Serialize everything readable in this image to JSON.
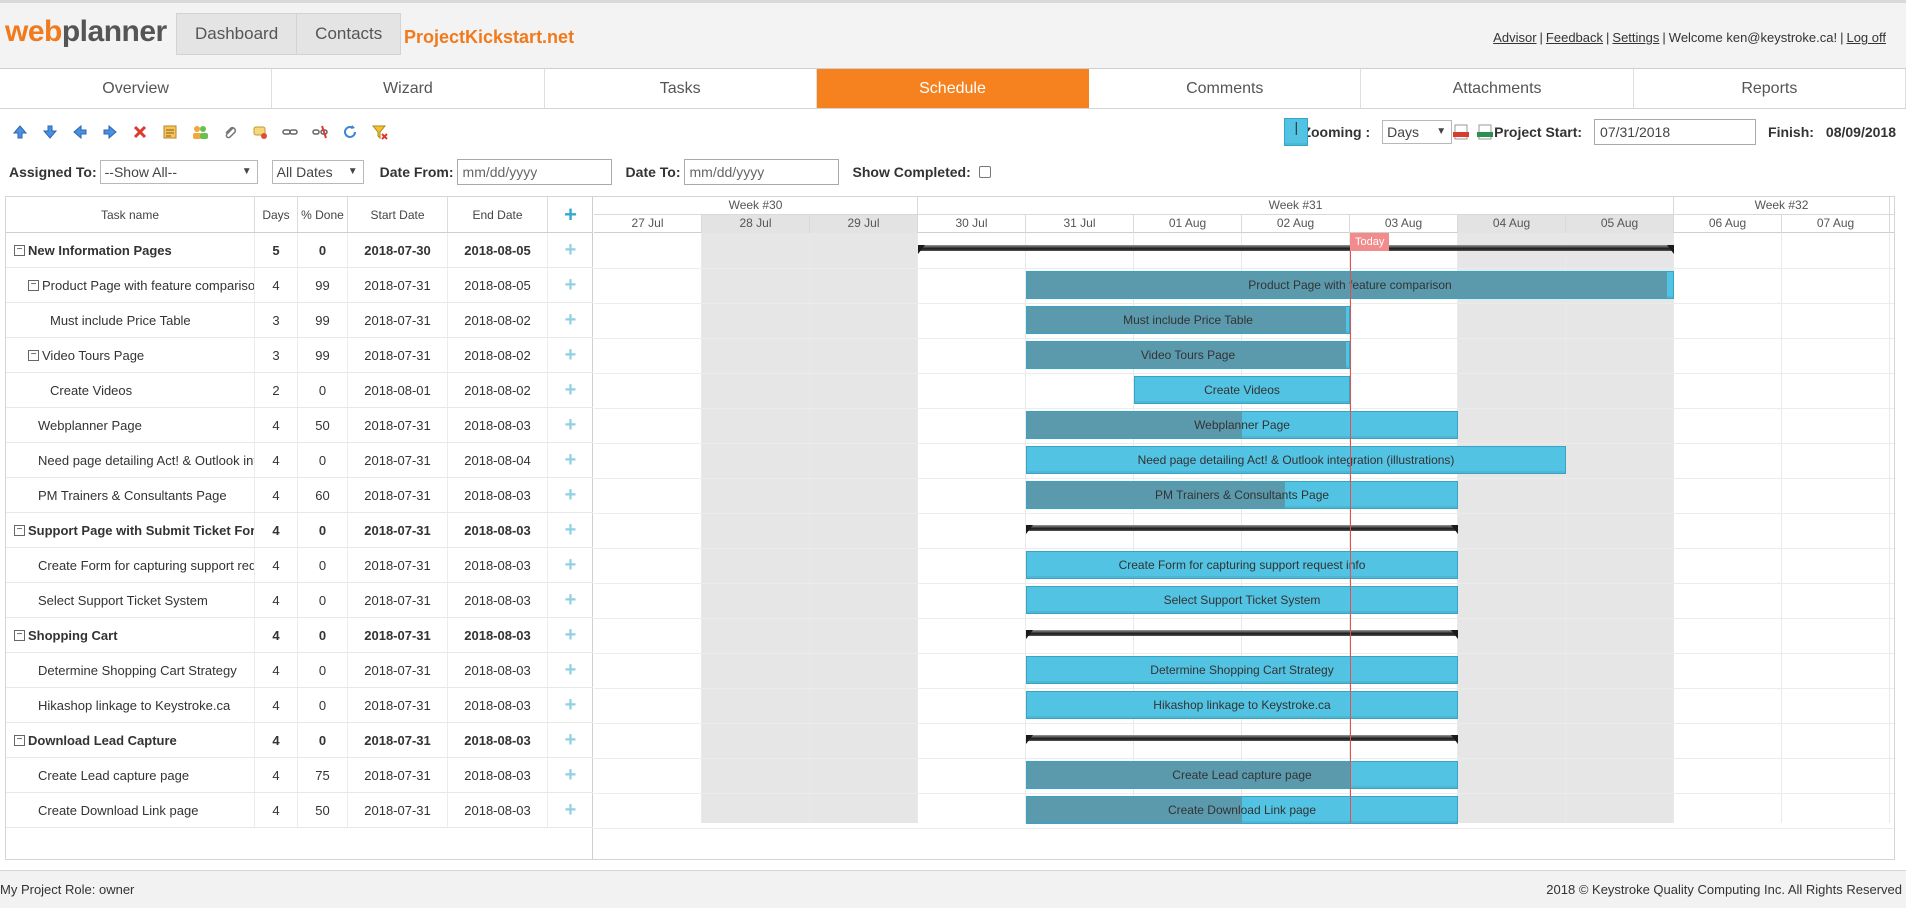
{
  "app": {
    "logo_part1": "web",
    "logo_part2": "planner",
    "nav_dashboard": "Dashboard",
    "nav_contacts": "Contacts",
    "project_name": "ProjectKickstart.net",
    "user_links": {
      "advisor": "Advisor",
      "feedback": "Feedback",
      "settings": "Settings",
      "welcome": "Welcome ken@keystroke.ca!",
      "logoff": "Log off"
    }
  },
  "tabs": [
    "Overview",
    "Wizard",
    "Tasks",
    "Schedule",
    "Comments",
    "Attachments",
    "Reports"
  ],
  "active_tab": "Schedule",
  "toolbar": {
    "icons": [
      "move-up-icon",
      "move-down-icon",
      "outdent-icon",
      "indent-icon",
      "delete-icon",
      "task-details-icon",
      "assign-resources-icon",
      "attachment-icon",
      "add-comment-icon",
      "link-tasks-icon",
      "unlink-tasks-icon",
      "refresh-icon",
      "clear-filter-icon"
    ],
    "zooming_label": "Zooming :",
    "zoom_value": "Days",
    "project_start_label": "Project Start:",
    "project_start_value": "07/31/2018",
    "finish_label": "Finish:",
    "finish_value": "08/09/2018"
  },
  "filters": {
    "assigned_label": "Assigned To:",
    "assigned_value": "--Show All--",
    "dates_value": "All Dates",
    "date_from_label": "Date From:",
    "date_from_placeholder": "mm/dd/yyyy",
    "date_to_label": "Date To:",
    "date_to_placeholder": "mm/dd/yyyy",
    "show_completed_label": "Show Completed:"
  },
  "grid": {
    "headers": {
      "name": "Task name",
      "days": "Days",
      "done": "% Done",
      "start": "Start Date",
      "end": "End Date",
      "add": "+"
    },
    "rows": [
      {
        "name": "New Information Pages",
        "days": "5",
        "done": "0",
        "start": "2018-07-30",
        "end": "2018-08-05",
        "level": 0,
        "summary": true,
        "toggle": "−"
      },
      {
        "name": "Product Page with feature comparison",
        "days": "4",
        "done": "99",
        "start": "2018-07-31",
        "end": "2018-08-05",
        "level": 1,
        "summary": false,
        "toggle": "−"
      },
      {
        "name": "Must include Price Table",
        "days": "3",
        "done": "99",
        "start": "2018-07-31",
        "end": "2018-08-02",
        "level": 2,
        "summary": false,
        "toggle": ""
      },
      {
        "name": "Video Tours Page",
        "days": "3",
        "done": "99",
        "start": "2018-07-31",
        "end": "2018-08-02",
        "level": 1,
        "summary": false,
        "toggle": "−"
      },
      {
        "name": "Create Videos",
        "days": "2",
        "done": "0",
        "start": "2018-08-01",
        "end": "2018-08-02",
        "level": 2,
        "summary": false,
        "toggle": ""
      },
      {
        "name": "Webplanner Page",
        "days": "4",
        "done": "50",
        "start": "2018-07-31",
        "end": "2018-08-03",
        "level": 1,
        "summary": false,
        "toggle": ""
      },
      {
        "name": "Need page detailing Act! & Outlook integration (illustrations)",
        "days": "4",
        "done": "0",
        "start": "2018-07-31",
        "end": "2018-08-04",
        "level": 1,
        "summary": false,
        "toggle": ""
      },
      {
        "name": "PM Trainers & Consultants Page",
        "days": "4",
        "done": "60",
        "start": "2018-07-31",
        "end": "2018-08-03",
        "level": 1,
        "summary": false,
        "toggle": ""
      },
      {
        "name": "Support Page with Submit Ticket Form",
        "days": "4",
        "done": "0",
        "start": "2018-07-31",
        "end": "2018-08-03",
        "level": 0,
        "summary": true,
        "toggle": "−"
      },
      {
        "name": "Create Form for capturing support request info",
        "days": "4",
        "done": "0",
        "start": "2018-07-31",
        "end": "2018-08-03",
        "level": 1,
        "summary": false,
        "toggle": ""
      },
      {
        "name": "Select Support Ticket System",
        "days": "4",
        "done": "0",
        "start": "2018-07-31",
        "end": "2018-08-03",
        "level": 1,
        "summary": false,
        "toggle": ""
      },
      {
        "name": "Shopping Cart",
        "days": "4",
        "done": "0",
        "start": "2018-07-31",
        "end": "2018-08-03",
        "level": 0,
        "summary": true,
        "toggle": "−"
      },
      {
        "name": "Determine Shopping Cart Strategy",
        "days": "4",
        "done": "0",
        "start": "2018-07-31",
        "end": "2018-08-03",
        "level": 1,
        "summary": false,
        "toggle": ""
      },
      {
        "name": "Hikashop linkage to Keystroke.ca",
        "days": "4",
        "done": "0",
        "start": "2018-07-31",
        "end": "2018-08-03",
        "level": 1,
        "summary": false,
        "toggle": ""
      },
      {
        "name": "Download Lead Capture",
        "days": "4",
        "done": "0",
        "start": "2018-07-31",
        "end": "2018-08-03",
        "level": 0,
        "summary": true,
        "toggle": "−"
      },
      {
        "name": "Create Lead capture page",
        "days": "4",
        "done": "75",
        "start": "2018-07-31",
        "end": "2018-08-03",
        "level": 1,
        "summary": false,
        "toggle": ""
      },
      {
        "name": "Create Download Link page",
        "days": "4",
        "done": "50",
        "start": "2018-07-31",
        "end": "2018-08-03",
        "level": 1,
        "summary": false,
        "toggle": ""
      }
    ]
  },
  "gantt": {
    "weeks": [
      {
        "label": "Week #30",
        "days": 3
      },
      {
        "label": "Week #31",
        "days": 7
      },
      {
        "label": "Week #32",
        "days": 2
      }
    ],
    "days": [
      {
        "label": "27 Jul",
        "weekend": false
      },
      {
        "label": "28 Jul",
        "weekend": true
      },
      {
        "label": "29 Jul",
        "weekend": true
      },
      {
        "label": "30 Jul",
        "weekend": false
      },
      {
        "label": "31 Jul",
        "weekend": false
      },
      {
        "label": "01 Aug",
        "weekend": false
      },
      {
        "label": "02 Aug",
        "weekend": false
      },
      {
        "label": "03 Aug",
        "weekend": false
      },
      {
        "label": "04 Aug",
        "weekend": true
      },
      {
        "label": "05 Aug",
        "weekend": true
      },
      {
        "label": "06 Aug",
        "weekend": false
      },
      {
        "label": "07 Aug",
        "weekend": false
      }
    ],
    "today_label": "Today",
    "today_day": "03 Aug",
    "bars": [
      {
        "type": "summary",
        "start_day": "30 Jul",
        "end_day": "05 Aug",
        "label": ""
      },
      {
        "type": "task",
        "start_day": "31 Jul",
        "end_day": "05 Aug",
        "done": 99,
        "label": "Product Page with feature comparison"
      },
      {
        "type": "task",
        "start_day": "31 Jul",
        "end_day": "02 Aug",
        "done": 99,
        "label": "Must include Price Table"
      },
      {
        "type": "task",
        "start_day": "31 Jul",
        "end_day": "02 Aug",
        "done": 99,
        "label": "Video Tours Page"
      },
      {
        "type": "task",
        "start_day": "01 Aug",
        "end_day": "02 Aug",
        "done": 0,
        "label": "Create Videos"
      },
      {
        "type": "task",
        "start_day": "31 Jul",
        "end_day": "03 Aug",
        "done": 50,
        "label": "Webplanner Page"
      },
      {
        "type": "task",
        "start_day": "31 Jul",
        "end_day": "04 Aug",
        "done": 0,
        "label": "Need page detailing Act! & Outlook integration (illustrations)"
      },
      {
        "type": "task",
        "start_day": "31 Jul",
        "end_day": "03 Aug",
        "done": 60,
        "label": "PM Trainers & Consultants Page"
      },
      {
        "type": "summary",
        "start_day": "31 Jul",
        "end_day": "03 Aug",
        "label": ""
      },
      {
        "type": "task",
        "start_day": "31 Jul",
        "end_day": "03 Aug",
        "done": 0,
        "label": "Create Form for capturing support request info"
      },
      {
        "type": "task",
        "start_day": "31 Jul",
        "end_day": "03 Aug",
        "done": 0,
        "label": "Select Support Ticket System"
      },
      {
        "type": "summary",
        "start_day": "31 Jul",
        "end_day": "03 Aug",
        "label": ""
      },
      {
        "type": "task",
        "start_day": "31 Jul",
        "end_day": "03 Aug",
        "done": 0,
        "label": "Determine Shopping Cart Strategy"
      },
      {
        "type": "task",
        "start_day": "31 Jul",
        "end_day": "03 Aug",
        "done": 0,
        "label": "Hikashop linkage to Keystroke.ca"
      },
      {
        "type": "summary",
        "start_day": "31 Jul",
        "end_day": "03 Aug",
        "label": ""
      },
      {
        "type": "task",
        "start_day": "31 Jul",
        "end_day": "03 Aug",
        "done": 75,
        "label": "Create Lead capture page"
      },
      {
        "type": "task",
        "start_day": "31 Jul",
        "end_day": "03 Aug",
        "done": 50,
        "label": "Create Download Link page"
      }
    ]
  },
  "footer": {
    "role": "My Project Role: owner",
    "copyright": "2018 © Keystroke Quality Computing Inc. All Rights Reserved"
  },
  "colors": {
    "accent": "#f5821f",
    "task_bar": "#52c3e2",
    "task_progress": "#5b9aad",
    "today_line": "#e25050"
  }
}
